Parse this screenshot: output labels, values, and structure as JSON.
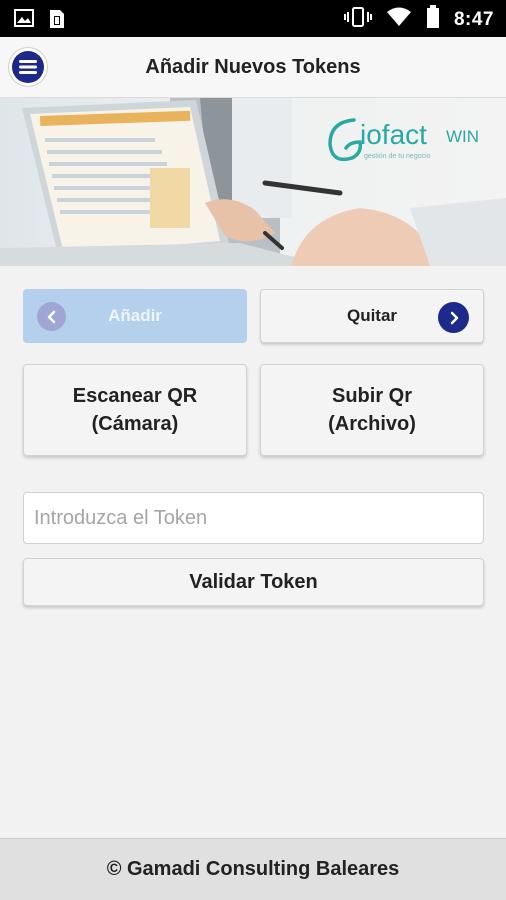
{
  "status_bar": {
    "time": "8:47",
    "icons": [
      "image-icon",
      "sim-card-icon",
      "vibrate-icon",
      "wifi-icon",
      "battery-icon"
    ]
  },
  "header": {
    "title": "Añadir Nuevos Tokens",
    "menu_icon": "menu-icon"
  },
  "banner": {
    "logo_text": "iofact",
    "logo_suffix": "WIN",
    "logo_tagline": "gestión de tu negocio"
  },
  "segment": {
    "add_label": "Añadir",
    "remove_label": "Quitar",
    "add_state": "selected"
  },
  "actions": {
    "scan_line1": "Escanear QR",
    "scan_line2": "(Cámara)",
    "upload_line1": "Subir Qr",
    "upload_line2": "(Archivo)"
  },
  "token": {
    "placeholder": "Introduzca el Token",
    "value": "",
    "validate_label": "Validar Token"
  },
  "footer": {
    "text": "© Gamadi Consulting Baleares"
  },
  "colors": {
    "accent": "#1d2a8c",
    "segment_selected": "#b4d0ec",
    "logo_teal": "#2aa9a3"
  }
}
